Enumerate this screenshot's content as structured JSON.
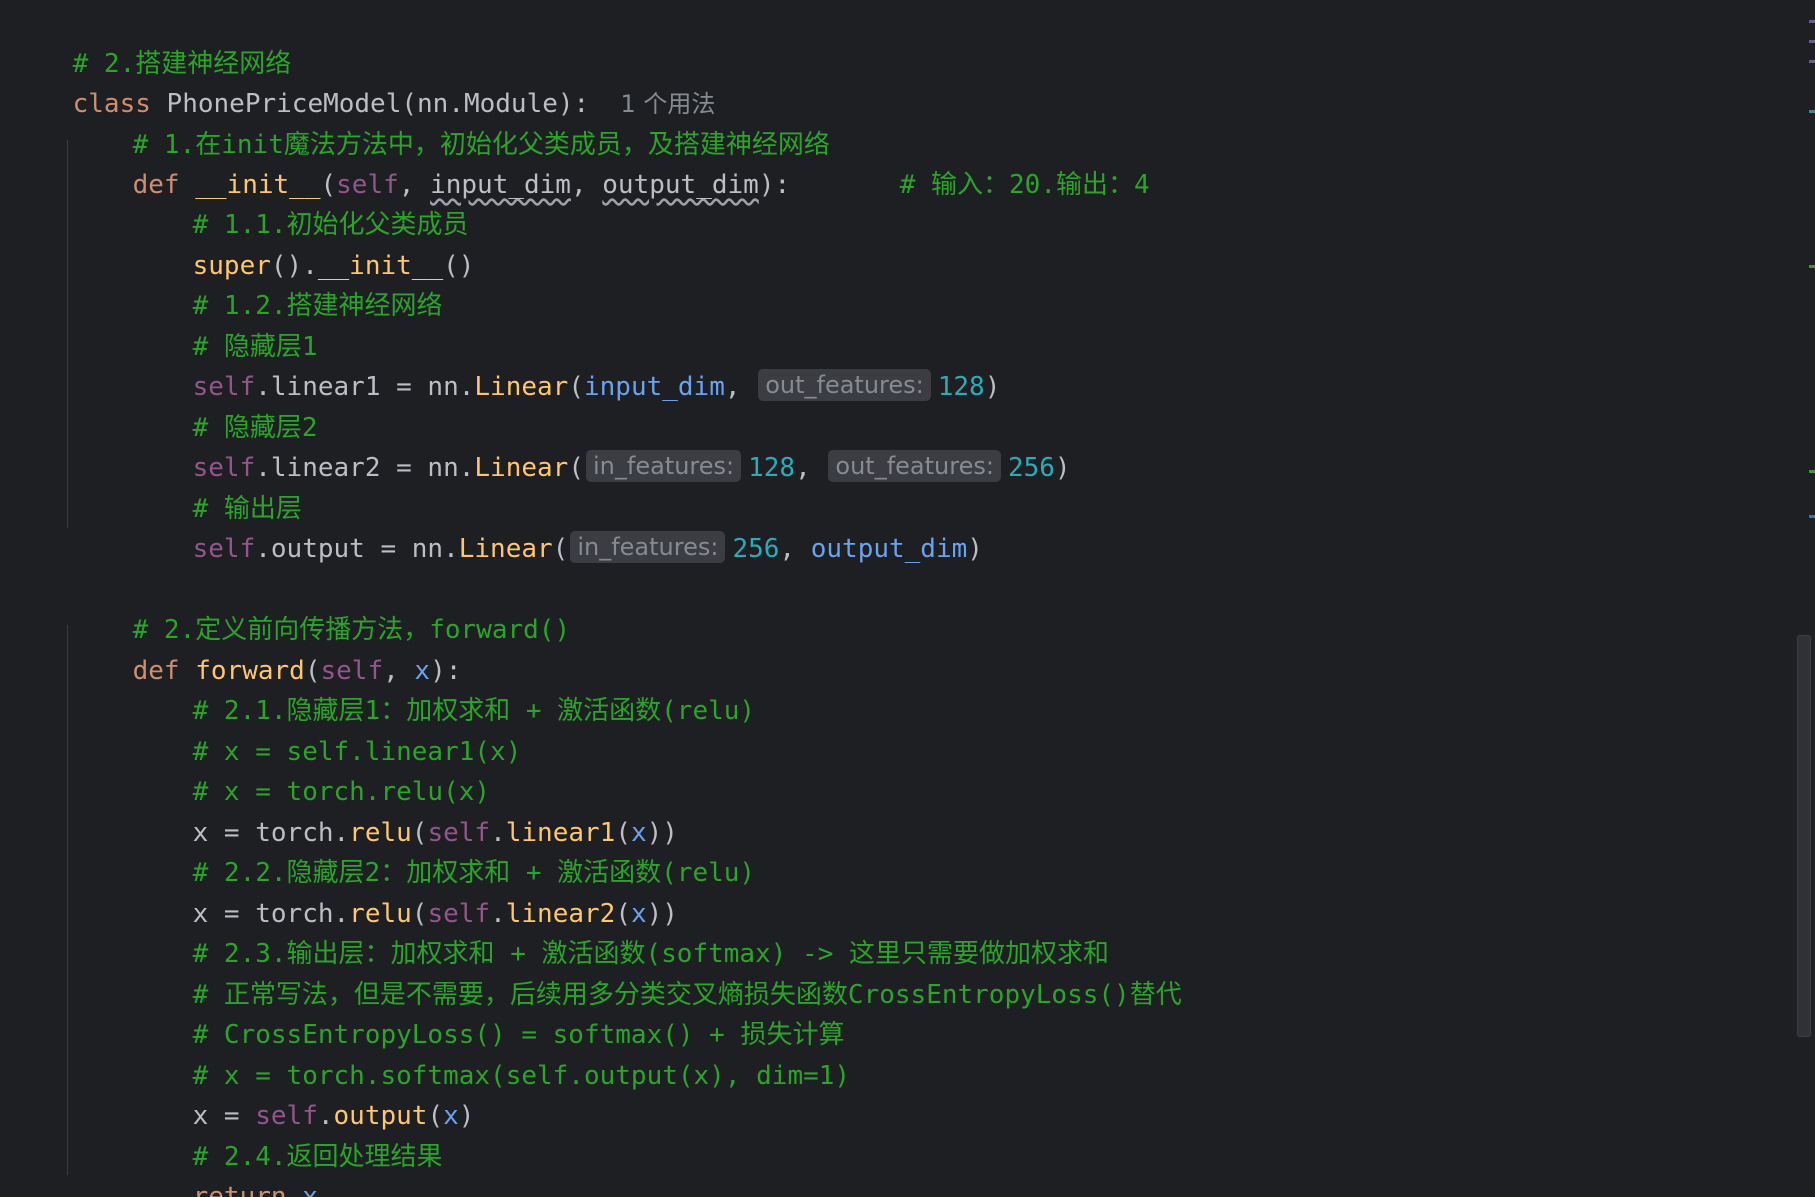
{
  "code": {
    "l1_comment": "# 2.搭建神经网络",
    "l2_kw": "class",
    "l2_name": " PhonePriceModel(nn.Module):",
    "l2_usage": "1 个用法",
    "l3_comment": "# 1.在init魔法方法中，初始化父类成员，及搭建神经网络",
    "l4_kw": "def",
    "l4_fn": "__init__",
    "l4_open": "(",
    "l4_self": "self",
    "l4_sep1": ", ",
    "l4_p1": "input_dim",
    "l4_sep2": ", ",
    "l4_p2": "output_dim",
    "l4_close": "):",
    "l4_comment": "# 输入：20.输出：4",
    "l5_comment": "# 1.1.初始化父类成员",
    "l6_super": "super",
    "l6_rest": "().",
    "l6_init": "__init__",
    "l6_end": "()",
    "l7_comment": "# 1.2.搭建神经网络",
    "l8_comment": "# 隐藏层1",
    "l9_self": "self",
    "l9_rest": ".linear1 = nn.",
    "l9_call": "Linear",
    "l9_open": "(",
    "l9_arg": "input_dim",
    "l9_sep": ", ",
    "l9_hint": "out_features:",
    "l9_num": "128",
    "l9_close": ")",
    "l10_comment": "# 隐藏层2",
    "l11_self": "self",
    "l11_rest": ".linear2 = nn.",
    "l11_call": "Linear",
    "l11_open": "(",
    "l11_hint1": "in_features:",
    "l11_num1": "128",
    "l11_sep": ", ",
    "l11_hint2": "out_features:",
    "l11_num2": "256",
    "l11_close": ")",
    "l12_comment": "# 输出层",
    "l13_self": "self",
    "l13_rest": ".output = nn.",
    "l13_call": "Linear",
    "l13_open": "(",
    "l13_hint": "in_features:",
    "l13_num": "256",
    "l13_sep": ", ",
    "l13_arg": "output_dim",
    "l13_close": ")",
    "l15_comment": "# 2.定义前向传播方法，forward()",
    "l16_kw": "def",
    "l16_fn": "forward",
    "l16_open": "(",
    "l16_self": "self",
    "l16_sep": ", ",
    "l16_x": "x",
    "l16_close": "):",
    "l17_comment": "# 2.1.隐藏层1：加权求和 + 激活函数(relu)",
    "l18_comment": "# x = self.linear1(x)",
    "l19_comment": "# x = torch.relu(x)",
    "l20_a": "x = torch.",
    "l20_call": "relu",
    "l20_open": "(",
    "l20_self": "self",
    "l20_dot": ".",
    "l20_call2": "linear1",
    "l20_open2": "(",
    "l20_x": "x",
    "l20_close": "))",
    "l21_comment": "# 2.2.隐藏层2：加权求和 + 激活函数(relu)",
    "l22_a": "x = torch.",
    "l22_call": "relu",
    "l22_open": "(",
    "l22_self": "self",
    "l22_dot": ".",
    "l22_call2": "linear2",
    "l22_open2": "(",
    "l22_x": "x",
    "l22_close": "))",
    "l23_comment": "# 2.3.输出层：加权求和 + 激活函数(softmax) -> 这里只需要做加权求和",
    "l24_comment": "# 正常写法，但是不需要，后续用多分类交叉熵损失函数CrossEntropyLoss()替代",
    "l25_comment": "# CrossEntropyLoss() = softmax() + 损失计算",
    "l26_comment": "# x = torch.softmax(self.output(x), dim=1)",
    "l27_a": "x = ",
    "l27_self": "self",
    "l27_dot": ".",
    "l27_call": "output",
    "l27_open": "(",
    "l27_x": "x",
    "l27_close": ")",
    "l28_comment": "# 2.4.返回处理结果",
    "l29_kw": "return",
    "l29_x": " x"
  },
  "colors": {
    "background": "#1e1f22",
    "comment": "#2aa52a",
    "keyword": "#cf8e6d",
    "function": "#ffc66d",
    "self": "#94558d",
    "number": "#2aacb8",
    "hint_bg": "#3b3d42"
  }
}
